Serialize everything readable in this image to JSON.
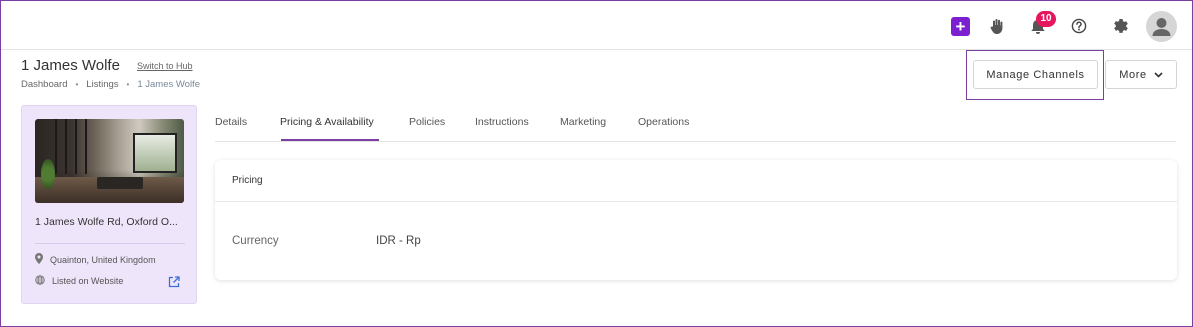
{
  "topbar": {
    "add_icon": "plus-icon",
    "hand_icon": "hand-icon",
    "bell_icon": "bell-icon",
    "notification_count": "10",
    "help_icon": "help-icon",
    "settings_icon": "gear-icon",
    "avatar_icon": "user-avatar-icon",
    "accent_color": "#7b1fd0",
    "badge_color": "#e5175f"
  },
  "header": {
    "title": "1 James Wolfe",
    "switch_hub": "Switch to Hub",
    "breadcrumb": [
      "Dashboard",
      "Listings",
      "1 James Wolfe"
    ],
    "manage_channels": "Manage Channels",
    "more": "More"
  },
  "listing_card": {
    "name": "1 James Wolfe Rd, Oxford O...",
    "location": "Quainton, United Kingdom",
    "listed": "Listed on Website",
    "card_color": "#efe5fa"
  },
  "tabs": [
    {
      "label": "Details"
    },
    {
      "label": "Pricing & Availability",
      "active": true
    },
    {
      "label": "Policies"
    },
    {
      "label": "Instructions"
    },
    {
      "label": "Marketing"
    },
    {
      "label": "Operations"
    }
  ],
  "pricing": {
    "title": "Pricing",
    "currency_label": "Currency",
    "currency_value": "IDR - Rp"
  }
}
